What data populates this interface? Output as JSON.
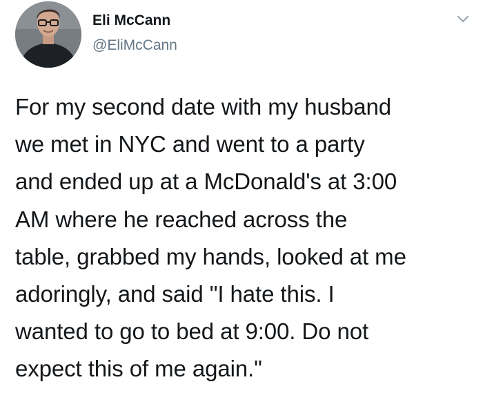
{
  "tweet": {
    "author_name": "Eli McCann",
    "author_handle": "@EliMcCann",
    "avatar_icon": "user-avatar-photo",
    "menu_icon": "chevron-down-icon",
    "text_lines": [
      "For my second date with my husband",
      "we met in NYC and went to a party",
      "and ended up at a McDonald's at 3:00",
      "AM where he reached across the",
      "table, grabbed my hands, looked at me",
      "adoringly, and said \"I hate this. I",
      "wanted to go to bed at 9:00. Do not",
      "expect this of me again.\""
    ]
  },
  "colors": {
    "text": "#14171a",
    "secondary": "#657786",
    "background": "#ffffff"
  }
}
